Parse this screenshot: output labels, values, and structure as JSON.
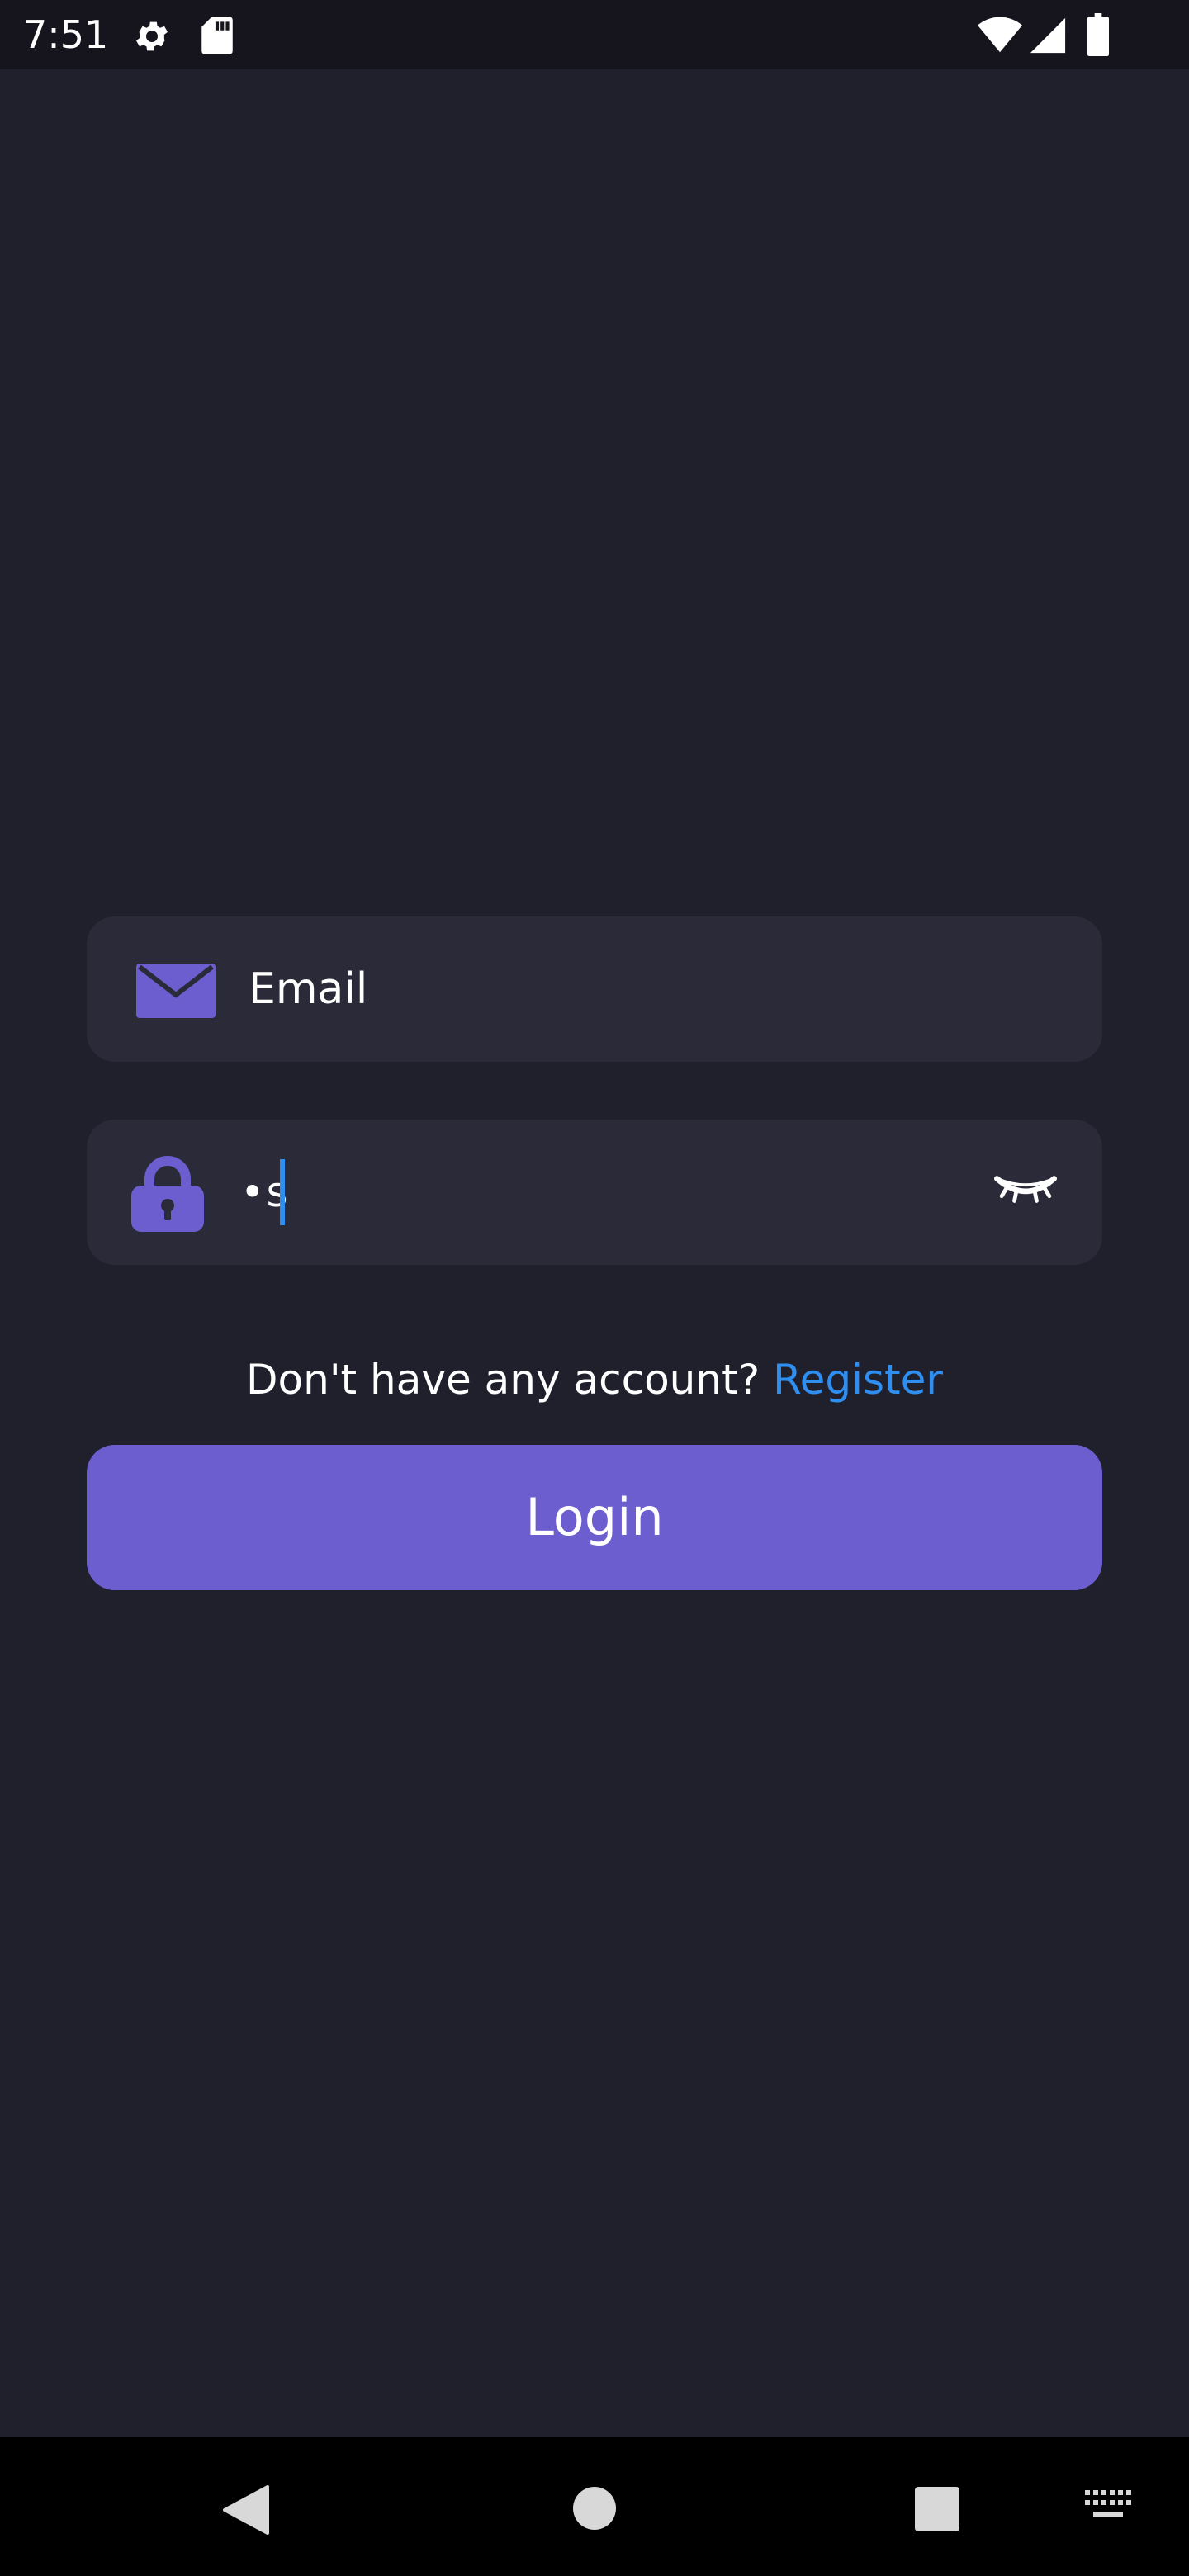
{
  "status_bar": {
    "time": "7:51",
    "icons": [
      "gear-icon",
      "sd-card-icon",
      "wifi-icon",
      "signal-icon",
      "battery-icon"
    ]
  },
  "login_form": {
    "email": {
      "icon": "mail-icon",
      "placeholder": "Email",
      "value": ""
    },
    "password": {
      "icon": "lock-icon",
      "value": "•s",
      "visibility_icon": "eye-closed-icon"
    },
    "register_prompt": "Don't have any account?",
    "register_link": "Register",
    "login_label": "Login"
  },
  "nav_bar": {
    "icons": [
      "back-icon",
      "home-icon",
      "recents-icon",
      "keyboard-icon"
    ]
  },
  "colors": {
    "background": "#201f2c",
    "field_background": "#2b2a38",
    "accent": "#6c5ecf",
    "link": "#2f8ff0",
    "text": "#ffffff"
  }
}
